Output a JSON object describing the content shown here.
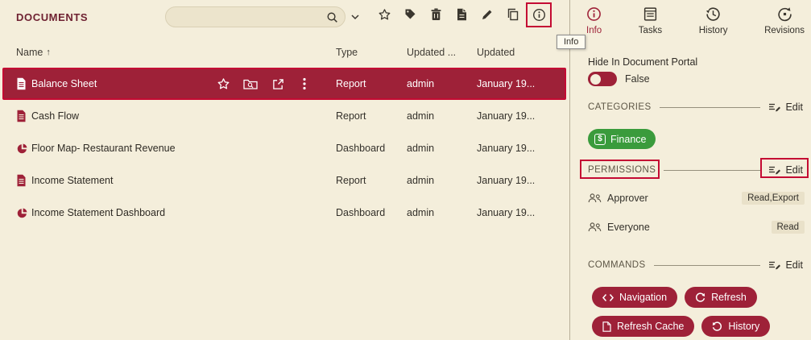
{
  "colors": {
    "background": "#f4eedb",
    "maroon": "#9e2138",
    "annotation_red": "#c40b33",
    "green": "#3a9b3c"
  },
  "left_panel": {
    "title": "DOCUMENTS",
    "search": {
      "value": "",
      "placeholder": ""
    },
    "toolbar_icons": [
      "search",
      "chevron-down",
      "favorite",
      "tag",
      "delete-document",
      "export-document",
      "edit",
      "copy",
      "info"
    ],
    "tooltip": "Info",
    "table": {
      "headers": {
        "name": "Name",
        "type": "Type",
        "updated_by": "Updated ...",
        "updated": "Updated"
      },
      "sort_arrow": "↑",
      "rows": [
        {
          "name": "Balance Sheet",
          "type": "Report",
          "updated_by": "admin",
          "updated": "January 19...",
          "icon": "report-document",
          "selected": true,
          "row_icons": [
            "favorite",
            "folder-search",
            "open-in-new",
            "more-vertical"
          ]
        },
        {
          "name": "Cash Flow",
          "type": "Report",
          "updated_by": "admin",
          "updated": "January 19...",
          "icon": "report-document",
          "selected": false
        },
        {
          "name": "Floor Map- Restaurant Revenue",
          "type": "Dashboard",
          "updated_by": "admin",
          "updated": "January 19...",
          "icon": "dashboard-pie",
          "selected": false
        },
        {
          "name": "Income Statement",
          "type": "Report",
          "updated_by": "admin",
          "updated": "January 19...",
          "icon": "report-document",
          "selected": false
        },
        {
          "name": "Income Statement Dashboard",
          "type": "Dashboard",
          "updated_by": "admin",
          "updated": "January 19...",
          "icon": "dashboard-pie",
          "selected": false
        }
      ]
    }
  },
  "right_panel": {
    "tabs": [
      {
        "label": "Info",
        "icon": "info-circle",
        "active": true
      },
      {
        "label": "Tasks",
        "icon": "tasks-clipboard",
        "active": false
      },
      {
        "label": "History",
        "icon": "history-clock",
        "active": false
      },
      {
        "label": "Revisions",
        "icon": "revisions-rotate",
        "active": false
      }
    ],
    "hide_in_portal": {
      "label": "Hide In Document Portal",
      "value": "False",
      "toggle_state": "off"
    },
    "categories_section": {
      "title": "CATEGORIES",
      "edit": "Edit"
    },
    "categories": [
      {
        "label": "Finance",
        "symbol": "$",
        "color": "#3a9b3c"
      }
    ],
    "permissions_section": {
      "title": "PERMISSIONS",
      "edit": "Edit"
    },
    "permissions": [
      {
        "name": "Approver",
        "rights": "Read,Export"
      },
      {
        "name": "Everyone",
        "rights": "Read"
      }
    ],
    "commands_section": {
      "title": "COMMANDS",
      "edit": "Edit"
    },
    "commands": [
      {
        "label": "Navigation",
        "icon": "code-brackets"
      },
      {
        "label": "Refresh",
        "icon": "refresh-cw"
      },
      {
        "label": "Refresh Cache",
        "icon": "document"
      },
      {
        "label": "History",
        "icon": "refresh-ccw"
      }
    ]
  }
}
